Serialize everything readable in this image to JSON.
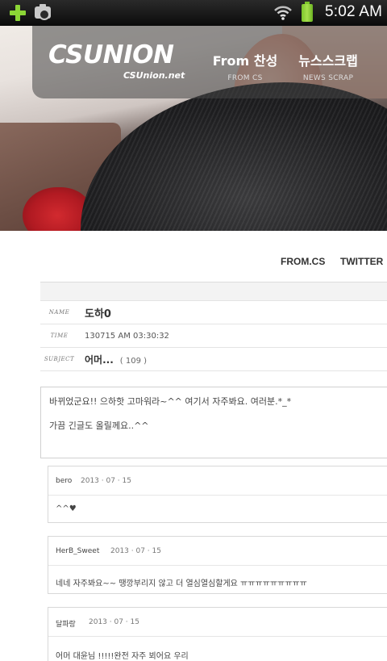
{
  "status_bar": {
    "time": "5:02 AM",
    "icons": [
      "plus-icon",
      "camera-icon",
      "wifi-icon",
      "battery-icon"
    ],
    "accent": "#8cd636"
  },
  "header": {
    "logo": "CSUNION",
    "logo_sub": "CSUnion.net",
    "nav": [
      {
        "label": "From 찬성",
        "sub": "FROM CS"
      },
      {
        "label": "뉴스스크랩",
        "sub": "NEWS SCRAP"
      }
    ]
  },
  "subnav": [
    "FROM.CS",
    "TWITTER"
  ],
  "post": {
    "name_label": "NAME",
    "name": "도하0",
    "time_label": "TIME",
    "time": "130715 AM 03:30:32",
    "subject_label": "SUBJECT",
    "subject": "어머...",
    "views": "( 109 )",
    "body_lines": [
      "바뀌었군요!! 으하핫 고마워라~^^ 여기서 자주봐요. 여러분.*_*",
      "가끔 긴글도 올릴께요..^^"
    ]
  },
  "comments": [
    {
      "author": "bero",
      "date": "2013 · 07 · 15",
      "text": "^^♥"
    },
    {
      "author": "HerB_Sweet",
      "date": "2013 · 07 · 15",
      "text": "네네 자주봐요~~ 땡깡부리지 않고 더 열심열심할게요 ㅠㅠㅠㅠㅠㅠㅠㅠㅠ"
    },
    {
      "author": "달파랑",
      "date": "2013 · 07 · 15",
      "text": "어머 대윤님 !!!!!완전 자주 뵈어요 우리"
    }
  ]
}
